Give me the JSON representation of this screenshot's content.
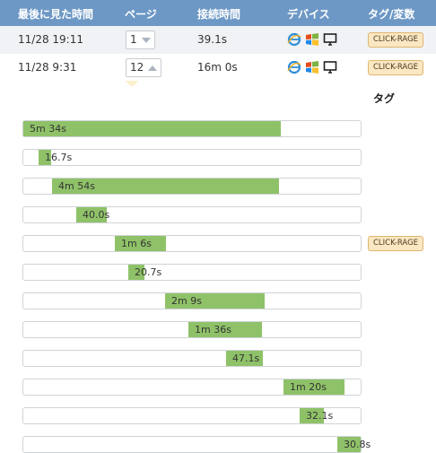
{
  "header": {
    "last_seen": "最後に見た時間",
    "pages": "ページ",
    "connect_time": "接続時間",
    "device": "デバイス",
    "tags": "タグ/変数"
  },
  "rows": [
    {
      "last_seen": "11/28 19:11",
      "pages": "1",
      "duration": "39.1s",
      "tag": "CLICK-RAGE",
      "devices": [
        "ie-icon",
        "windows-icon",
        "desktop-icon"
      ]
    },
    {
      "last_seen": "11/28 9:31",
      "pages": "12",
      "duration": "16m 0s",
      "tag": "CLICK-RAGE",
      "devices": [
        "ie-icon",
        "windows-icon",
        "desktop-icon"
      ]
    }
  ],
  "detail": {
    "tags_heading": "タグ",
    "timeline": [
      {
        "label": "5m 34s",
        "start": 0.0,
        "end": 0.762
      },
      {
        "label": "16.7s",
        "start": 0.044,
        "end": 0.082
      },
      {
        "label": "4m 54s",
        "start": 0.084,
        "end": 0.757
      },
      {
        "label": "40.0s",
        "start": 0.157,
        "end": 0.248
      },
      {
        "label": "1m 6s",
        "start": 0.27,
        "end": 0.421,
        "tag": "CLICK-RAGE"
      },
      {
        "label": "20.7s",
        "start": 0.31,
        "end": 0.357
      },
      {
        "label": "2m 9s",
        "start": 0.421,
        "end": 0.715
      },
      {
        "label": "1m 36s",
        "start": 0.49,
        "end": 0.709
      },
      {
        "label": "47.1s",
        "start": 0.601,
        "end": 0.709
      },
      {
        "label": "1m 20s",
        "start": 0.77,
        "end": 0.952
      },
      {
        "label": "32.1s",
        "start": 0.818,
        "end": 0.891
      },
      {
        "label": "30.8s",
        "start": 0.93,
        "end": 1.0
      }
    ]
  },
  "colors": {
    "header_bg": "#6d98c5",
    "bar": "#8fc268",
    "tag_bg": "#fbe7c2",
    "tag_border": "#e0b66e"
  }
}
